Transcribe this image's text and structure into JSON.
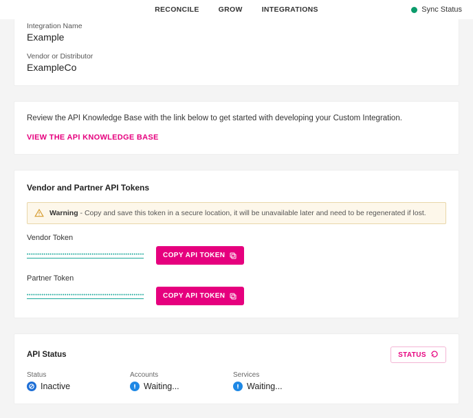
{
  "nav": {
    "reconcile": "RECONCILE",
    "grow": "GROW",
    "integrations": "INTEGRATIONS",
    "sync_status": "Sync Status"
  },
  "integration": {
    "name_label": "Integration Name",
    "name_value": "Example",
    "vendor_label": "Vendor or Distributor",
    "vendor_value": "ExampleCo"
  },
  "kb": {
    "text": "Review the API Knowledge Base with the link below to get started with developing your Custom Integration.",
    "link": "VIEW THE API KNOWLEDGE BASE"
  },
  "tokens": {
    "title": "Vendor and Partner API Tokens",
    "warning_label": "Warning",
    "warning_text": " - Copy and save this token in a secure location, it will be unavailable later and need to be regenerated if lost.",
    "vendor_label": "Vendor Token",
    "vendor_mask": "••••••••••••••••••••••••••••••••••••••••••••••••••••••••••••••••••",
    "partner_label": "Partner Token",
    "partner_mask": "••••••••••••••••••••••••••••••••••••••••••••••••••••••••••••••••••",
    "copy_btn": "COPY API TOKEN"
  },
  "api_status": {
    "title": "API Status",
    "refresh_btn": "STATUS",
    "cols": {
      "status_label": "Status",
      "status_value": "Inactive",
      "accounts_label": "Accounts",
      "accounts_value": "Waiting...",
      "services_label": "Services",
      "services_value": "Waiting..."
    }
  }
}
